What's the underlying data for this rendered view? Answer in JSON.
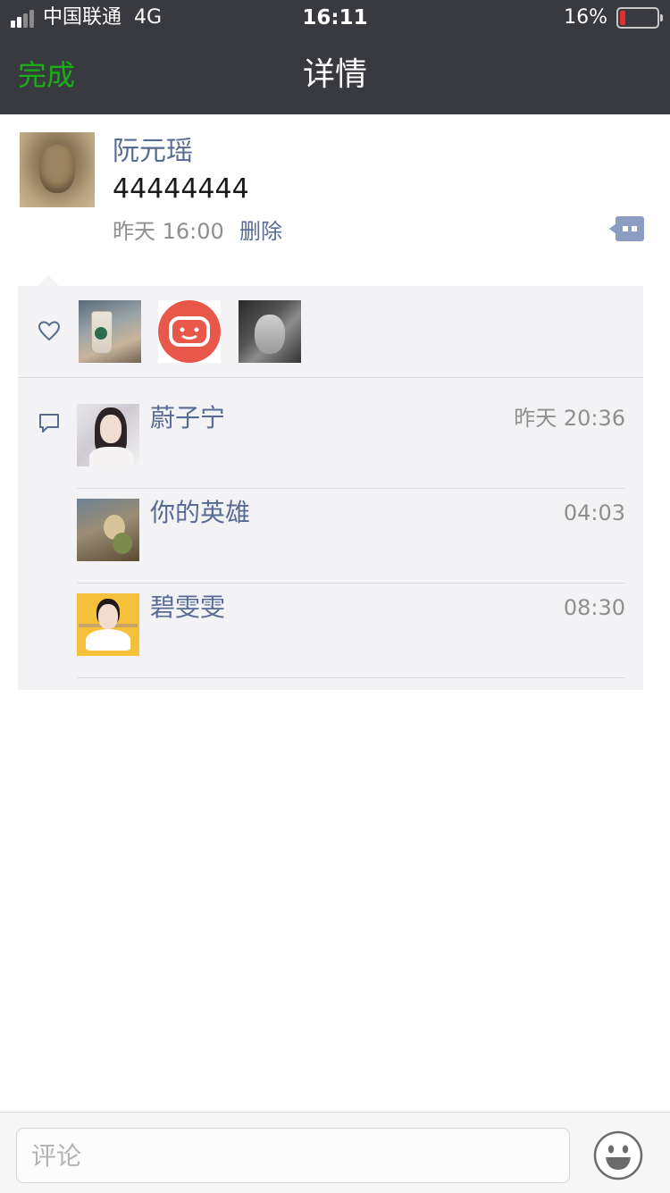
{
  "status_bar": {
    "carrier": "中国联通",
    "network": "4G",
    "time": "16:11",
    "battery_percent_label": "16%",
    "battery_level": 0.16
  },
  "navbar": {
    "done_label": "完成",
    "title": "详情"
  },
  "post": {
    "author": "阮元瑶",
    "text": "44444444",
    "time": "昨天 16:00",
    "delete_label": "删除"
  },
  "likes": {
    "icon": "heart-outline-icon",
    "avatars": [
      "starbucks-cup-avatar",
      "red-smile-avatar",
      "bw-portrait-avatar"
    ]
  },
  "comments": {
    "icon": "speech-bubble-icon",
    "items": [
      {
        "name": "蔚子宁",
        "time": "昨天 20:36"
      },
      {
        "name": "你的英雄",
        "time": "04:03"
      },
      {
        "name": "碧雯雯",
        "time": "08:30"
      }
    ]
  },
  "input_bar": {
    "placeholder": "评论",
    "emoji_icon": "smiley-face-icon"
  },
  "colors": {
    "nav_bg": "#393a3f",
    "done_green": "#1aad19",
    "name_blue": "#576b95",
    "panel_bg": "#f3f3f5",
    "battery_red": "#e3302d"
  }
}
